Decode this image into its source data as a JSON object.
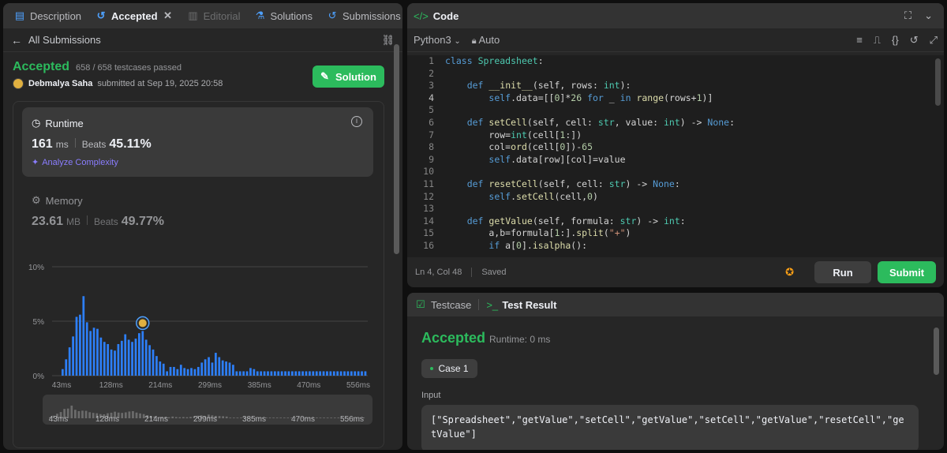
{
  "left_tabs": {
    "description": "Description",
    "accepted": "Accepted",
    "editorial": "Editorial",
    "solutions": "Solutions",
    "submissions": "Submissions"
  },
  "subnav": {
    "back_label": "All Submissions"
  },
  "submission": {
    "status": "Accepted",
    "testcases": "658 / 658 testcases passed",
    "author": "Debmalya Saha",
    "submitted_text": "submitted at Sep 19, 2025 20:58",
    "solution_button": "Solution"
  },
  "runtime": {
    "title": "Runtime",
    "value": "161",
    "unit": "ms",
    "beats_label": "Beats",
    "beats_value": "45.11%",
    "analyze_label": "Analyze Complexity"
  },
  "memory": {
    "title": "Memory",
    "value": "23.61",
    "unit": "MB",
    "beats_label": "Beats",
    "beats_value": "49.77%"
  },
  "chart_data": {
    "type": "bar",
    "title": "",
    "xlabel": "",
    "ylabel": "",
    "ylim": [
      0,
      10
    ],
    "y_ticks": [
      "10%",
      "5%",
      "0%"
    ],
    "x_ticks": [
      "43ms",
      "128ms",
      "214ms",
      "299ms",
      "385ms",
      "470ms",
      "556ms"
    ],
    "highlight_index": 23,
    "values": [
      0.6,
      1.5,
      2.6,
      3.6,
      5.4,
      5.6,
      7.3,
      4.9,
      4.1,
      4.4,
      4.3,
      3.5,
      3.1,
      2.9,
      2.4,
      2.3,
      2.9,
      3.2,
      3.8,
      3.3,
      3.1,
      3.4,
      3.9,
      4.1,
      3.3,
      2.8,
      2.4,
      1.8,
      1.3,
      1.1,
      0.4,
      0.8,
      0.8,
      0.6,
      1.0,
      0.7,
      0.6,
      0.7,
      0.6,
      0.8,
      1.2,
      1.5,
      1.7,
      1.2,
      2.1,
      1.7,
      1.4,
      1.3,
      1.2,
      1.0,
      0.4,
      0.4,
      0.4,
      0.4,
      0.7,
      0.6,
      0.4,
      0.4,
      0.4,
      0.4,
      0.4,
      0.4,
      0.4,
      0.4,
      0.4,
      0.4,
      0.4,
      0.4,
      0.4,
      0.4,
      0.4,
      0.4,
      0.4,
      0.4,
      0.4,
      0.4,
      0.4,
      0.4,
      0.4,
      0.4,
      0.4,
      0.4,
      0.4,
      0.4,
      0.4,
      0.4,
      0.4,
      0.4
    ]
  },
  "code_panel": {
    "title": "Code",
    "language": "Python3",
    "auto_label": "Auto",
    "status_pos": "Ln 4, Col 48",
    "status_saved": "Saved",
    "run_label": "Run",
    "submit_label": "Submit"
  },
  "test_panel": {
    "testcase_tab": "Testcase",
    "result_tab": "Test Result",
    "status": "Accepted",
    "runtime": "Runtime: 0 ms",
    "case_label": "Case 1",
    "input_label": "Input",
    "input_value": "[\"Spreadsheet\",\"getValue\",\"setCell\",\"getValue\",\"setCell\",\"getValue\",\"resetCell\",\"getValue\"]"
  }
}
